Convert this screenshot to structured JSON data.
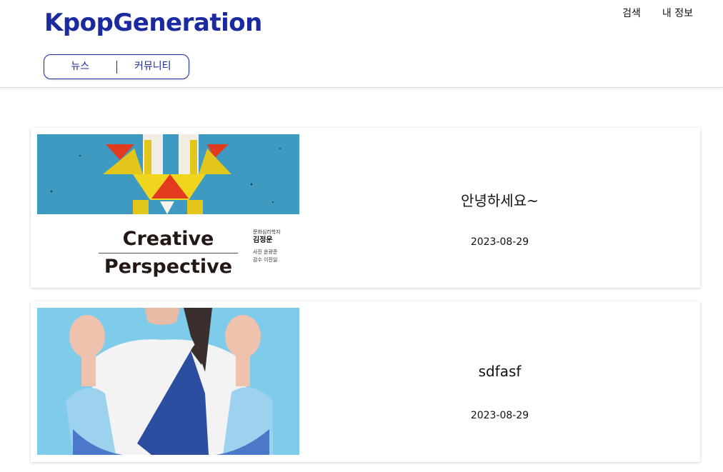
{
  "header": {
    "logo": "KpopGeneration",
    "search_label": "검색",
    "profile_label": "내 정보",
    "tabs": [
      {
        "label": "뉴스"
      },
      {
        "label": "커뮤니티"
      }
    ]
  },
  "posts": [
    {
      "title": "안녕하세요~",
      "date": "2023-08-29",
      "cover_text": {
        "line1": "Creative",
        "line2": "Perspective",
        "side1": "문화심리학자",
        "side2": "김정운",
        "side3": "사진 윤광준",
        "side4": "감수 이진일"
      }
    },
    {
      "title": "sdfasf",
      "date": "2023-08-29"
    }
  ],
  "colors": {
    "brand": "#1b2a9e",
    "cover_blue": "#3e9ac0",
    "photo_blue": "#7fcbea"
  }
}
